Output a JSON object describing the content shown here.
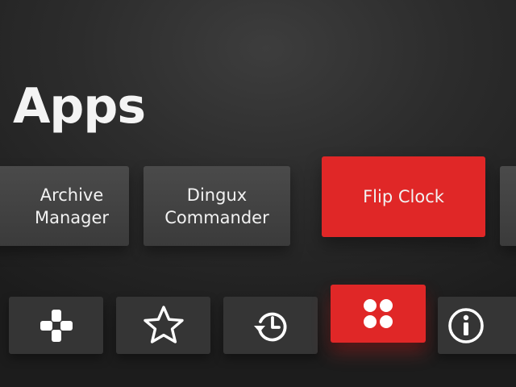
{
  "header": {
    "title": "Apps"
  },
  "apps": {
    "items": [
      {
        "line1": "Archive",
        "line2": "Manager"
      },
      {
        "line1": "Dingux",
        "line2": "Commander"
      },
      {
        "line1": "Flip Clock",
        "line2": ""
      },
      {
        "line1": "",
        "line2": ""
      }
    ],
    "selected": "Flip Clock"
  },
  "nav": {
    "items": [
      {
        "icon": "gamepad-icon"
      },
      {
        "icon": "star-icon"
      },
      {
        "icon": "history-icon"
      },
      {
        "icon": "apps-grid-icon"
      },
      {
        "icon": "info-icon"
      }
    ],
    "selected": "apps-grid-icon"
  },
  "colors": {
    "accent": "#e02727",
    "background": "#2c2c2c",
    "tile": "#444444",
    "text": "#ffffff"
  }
}
